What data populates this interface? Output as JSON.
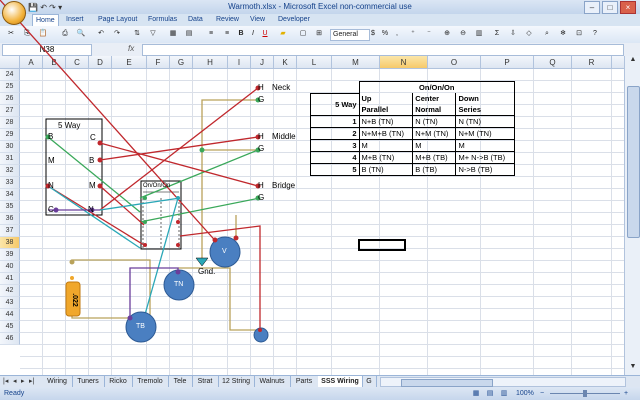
{
  "window": {
    "title": "Warmoth.xlsx - Microsoft Excel non-commercial use",
    "minimize": "–",
    "maximize": "□",
    "close": "×"
  },
  "qat": {
    "save": "💾",
    "undo": "↶",
    "redo": "↷",
    "more": "▾"
  },
  "ribbon_tabs": [
    "Home",
    "Insert",
    "Page Layout",
    "Formulas",
    "Data",
    "Review",
    "View",
    "Developer"
  ],
  "ribbon": {
    "bold": "B",
    "italic": "I",
    "underline": "U",
    "number_format": "General",
    "currency": "$",
    "percent": "%",
    "comma": ","
  },
  "formula_bar": {
    "name_box": "N38",
    "fx": "fx",
    "value": ""
  },
  "columns": [
    "A",
    "B",
    "C",
    "D",
    "E",
    "F",
    "G",
    "H",
    "I",
    "J",
    "K",
    "L",
    "M",
    "N",
    "O",
    "P",
    "Q",
    "R",
    "S"
  ],
  "rows": [
    "24",
    "25",
    "26",
    "27",
    "28",
    "29",
    "30",
    "31",
    "32",
    "33",
    "34",
    "35",
    "36",
    "37",
    "38",
    "39",
    "40",
    "41",
    "42",
    "43",
    "44",
    "45",
    "46"
  ],
  "selected_cell": {
    "column": "N",
    "row": "38"
  },
  "labels": {
    "five_way_box": "5 Way",
    "switch_b": "B",
    "switch_c_top": "C",
    "switch_m_left": "M",
    "switch_b_right": "B",
    "switch_n": "N",
    "switch_m_right": "M",
    "switch_c_bottom": "C",
    "switch_n_bottom": "N",
    "onoffon_box": "On/On/On",
    "neck_h": "H",
    "neck": "Neck",
    "neck_g": "G",
    "middle_h": "H",
    "middle": "Middle",
    "middle_g": "G",
    "bridge_h": "H",
    "bridge": "Bridge",
    "bridge_g": "G",
    "pot_v": "V",
    "gnd": "Gnd.",
    "pot_tn": "TN",
    "pot_tb": "TB",
    "cap": ".022"
  },
  "table": {
    "header_title": "On/On/On",
    "row_label": "5 Way",
    "sub_headers": [
      "Up",
      "Center",
      "Down"
    ],
    "sub_headers2": [
      "Parallel",
      "Normal",
      "Series"
    ],
    "rows": [
      {
        "n": "1",
        "up": "N+B (TN)",
        "center": "N (TN)",
        "down": "N (TN)"
      },
      {
        "n": "2",
        "up": "N+M+B (TN)",
        "center": "N+M (TN)",
        "down": "N+M (TN)"
      },
      {
        "n": "3",
        "up": "M",
        "center": "M",
        "down": "M"
      },
      {
        "n": "4",
        "up": "M+B (TN)",
        "center": "M+B (TB)",
        "down": "M+ N->B (TB)"
      },
      {
        "n": "5",
        "up": "B (TN)",
        "center": "B (TB)",
        "down": "N->B (TB)"
      }
    ]
  },
  "sheet_tabs": [
    "Wiring",
    "Tuners",
    "Ricko",
    "Tremolo",
    "Tele",
    "Strat",
    "12 String",
    "Walnuts",
    "Parts",
    "SSS Wiring",
    "G"
  ],
  "active_sheet": "SSS Wiring",
  "status": {
    "left": "Ready",
    "zoom": "100%",
    "zoom_out": "−",
    "zoom_in": "+"
  },
  "colors": {
    "wire_red": "#c0282d",
    "wire_green": "#3aa85a",
    "wire_khaki": "#b9a25a",
    "wire_teal": "#2aa7b7",
    "wire_purple": "#6a3d9a",
    "pot_blue": "#4a7fc1",
    "cap_orange": "#f0a72b"
  }
}
